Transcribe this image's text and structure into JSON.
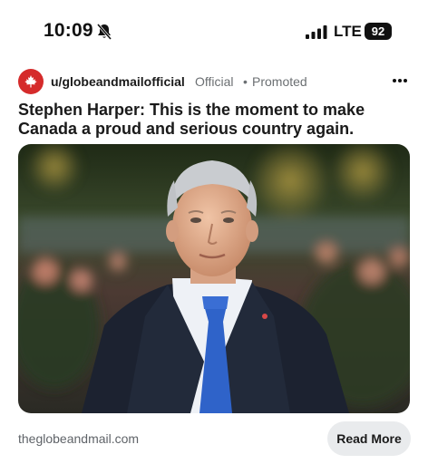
{
  "status_bar": {
    "time": "10:09",
    "network": "LTE",
    "battery": "92",
    "icons": [
      "bell-muted-icon",
      "signal-icon"
    ]
  },
  "post": {
    "author": "u/globeandmailofficial",
    "badge": "Official",
    "separator": "•",
    "label": "Promoted",
    "title": "Stephen Harper: This is the moment to make Canada a proud and serious country again.",
    "domain": "theglobeandmail.com",
    "cta": "Read More",
    "avatar_color": "#d52b2b",
    "icons": [
      "maple-leaf-icon",
      "more-options-icon"
    ]
  }
}
